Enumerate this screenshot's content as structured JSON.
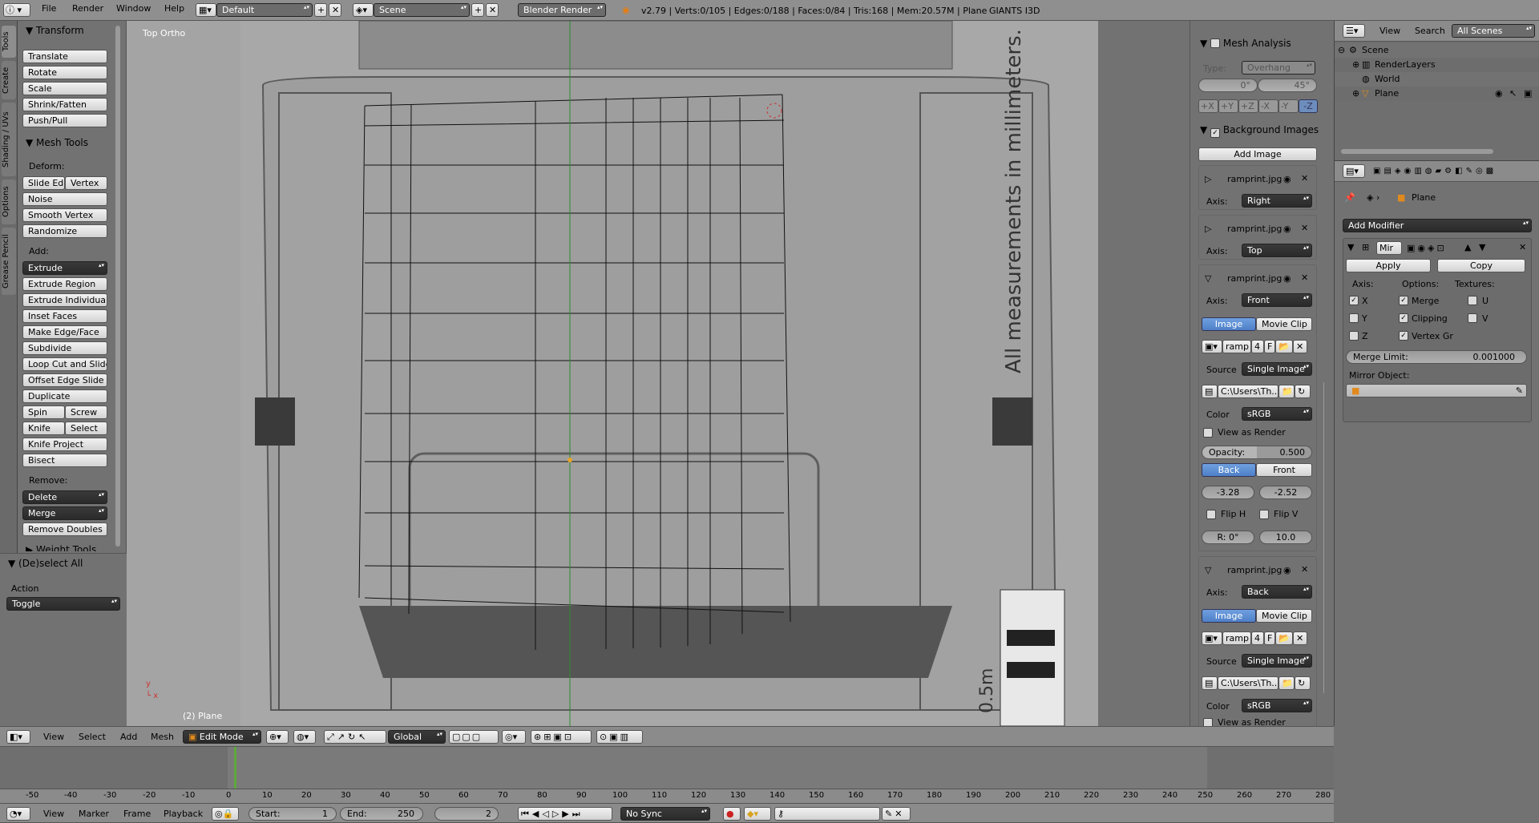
{
  "topbar": {
    "menus": [
      "File",
      "Render",
      "Window",
      "Help"
    ],
    "layout": "Default",
    "scene": "Scene",
    "engine": "Blender Render",
    "stats": "v2.79 | Verts:0/105 | Edges:0/188 | Faces:0/84 | Tris:168 | Mem:20.57M | Plane",
    "addon": "GIANTS I3D"
  },
  "tool_tabs": [
    "Tools",
    "Create",
    "Shading / UVs",
    "Options",
    "Grease Pencil"
  ],
  "toolshelf": {
    "transform_header": "Transform",
    "transform": [
      "Translate",
      "Rotate",
      "Scale",
      "Shrink/Fatten",
      "Push/Pull"
    ],
    "meshtools_header": "Mesh Tools",
    "deform_label": "Deform:",
    "slide_edge": "Slide Ed",
    "vertex": "Vertex",
    "deform": [
      "Noise",
      "Smooth Vertex",
      "Randomize"
    ],
    "add_label": "Add:",
    "extrude": "Extrude",
    "add": [
      "Extrude Region",
      "Extrude Individual",
      "Inset Faces",
      "Make Edge/Face",
      "Subdivide",
      "Loop Cut and Slide",
      "Offset Edge Slide",
      "Duplicate"
    ],
    "spin": "Spin",
    "screw": "Screw",
    "knife": "Knife",
    "select": "Select",
    "add2": [
      "Knife Project",
      "Bisect"
    ],
    "remove_label": "Remove:",
    "delete": "Delete",
    "merge": "Merge",
    "remove_doubles": "Remove Doubles",
    "weight_tools": "Weight Tools"
  },
  "operator": {
    "header": "(De)select All",
    "action_label": "Action",
    "action_value": "Toggle"
  },
  "viewport": {
    "view_name": "Top Ortho",
    "object_label": "(2) Plane",
    "blueprint_text": "All measurements in millimeters.",
    "scale_text": "0.5m"
  },
  "properties_n": {
    "mesh_analysis": "Mesh Analysis",
    "type_label": "Type:",
    "type_value": "Overhang",
    "angle_min": "0°",
    "angle_max": "45°",
    "axes": [
      "+X",
      "+Y",
      "+Z",
      "-X",
      "-Y",
      "-Z"
    ],
    "bg_images": "Background Images",
    "add_image": "Add Image",
    "images": [
      {
        "name": "ramprint.jpg",
        "axis": "Right"
      },
      {
        "name": "ramprint.jpg",
        "axis": "Top"
      },
      {
        "name": "ramprint.jpg",
        "axis": "Front"
      },
      {
        "name": "ramprint.jpg",
        "axis": "Back"
      }
    ],
    "axis_label": "Axis:",
    "image_tab": "Image",
    "movie_tab": "Movie Clip",
    "img_short": "ramp",
    "img_users": "4",
    "img_f": "F",
    "source_label": "Source",
    "source_value": "Single Image",
    "path": "C:\\Users\\Th...",
    "color_label": "Color",
    "color_value": "sRGB",
    "view_as_render": "View as Render",
    "opacity_label": "Opacity:",
    "opacity_value": "0.500",
    "back": "Back",
    "front": "Front",
    "off_x": "-3.28",
    "off_y": "-2.52",
    "flip_h": "Flip H",
    "flip_v": "Flip V",
    "rot": "R: 0°",
    "size": "10.0"
  },
  "outliner": {
    "view": "View",
    "search": "Search",
    "filter": "All Scenes",
    "items": [
      "Scene",
      "RenderLayers",
      "World",
      "Plane"
    ]
  },
  "modifiers": {
    "object_name": "Plane",
    "add_modifier": "Add Modifier",
    "mod_name": "Mir",
    "apply": "Apply",
    "copy": "Copy",
    "axis_label": "Axis:",
    "options_label": "Options:",
    "textures_label": "Textures:",
    "x": "X",
    "y": "Y",
    "z": "Z",
    "merge": "Merge",
    "clipping": "Clipping",
    "vertex_gr": "Vertex Gr",
    "u": "U",
    "v": "V",
    "merge_limit_label": "Merge Limit:",
    "merge_limit": "0.001000",
    "mirror_object": "Mirror Object:"
  },
  "view3d_header": {
    "menus": [
      "View",
      "Select",
      "Add",
      "Mesh"
    ],
    "mode": "Edit Mode",
    "orient": "Global"
  },
  "timeline": {
    "ticks": [
      "-50",
      "-40",
      "-30",
      "-20",
      "-10",
      "0",
      "10",
      "20",
      "30",
      "40",
      "50",
      "60",
      "70",
      "80",
      "90",
      "100",
      "110",
      "120",
      "130",
      "140",
      "150",
      "160",
      "170",
      "180",
      "190",
      "200",
      "210",
      "220",
      "230",
      "240",
      "250",
      "260",
      "270",
      "280"
    ],
    "menus": [
      "View",
      "Marker",
      "Frame",
      "Playback"
    ],
    "start": "Start:",
    "start_val": "1",
    "end": "End:",
    "end_val": "250",
    "current": "2",
    "sync": "No Sync"
  }
}
